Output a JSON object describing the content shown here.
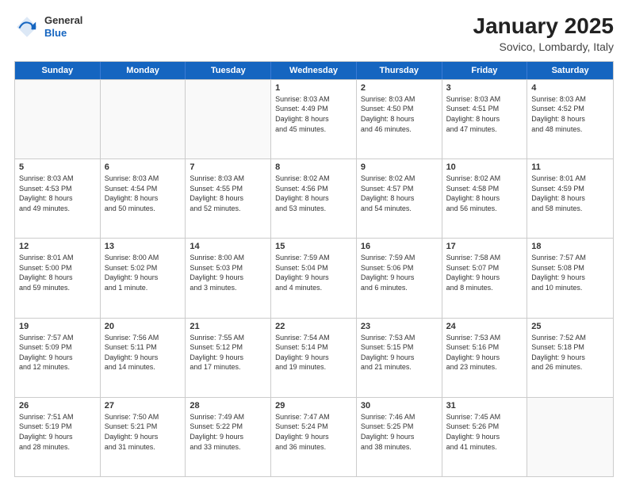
{
  "header": {
    "logo_general": "General",
    "logo_blue": "Blue",
    "month_title": "January 2025",
    "location": "Sovico, Lombardy, Italy"
  },
  "weekdays": [
    "Sunday",
    "Monday",
    "Tuesday",
    "Wednesday",
    "Thursday",
    "Friday",
    "Saturday"
  ],
  "weeks": [
    [
      {
        "day": "",
        "empty": true,
        "text": ""
      },
      {
        "day": "",
        "empty": true,
        "text": ""
      },
      {
        "day": "",
        "empty": true,
        "text": ""
      },
      {
        "day": "1",
        "empty": false,
        "text": "Sunrise: 8:03 AM\nSunset: 4:49 PM\nDaylight: 8 hours\nand 45 minutes."
      },
      {
        "day": "2",
        "empty": false,
        "text": "Sunrise: 8:03 AM\nSunset: 4:50 PM\nDaylight: 8 hours\nand 46 minutes."
      },
      {
        "day": "3",
        "empty": false,
        "text": "Sunrise: 8:03 AM\nSunset: 4:51 PM\nDaylight: 8 hours\nand 47 minutes."
      },
      {
        "day": "4",
        "empty": false,
        "text": "Sunrise: 8:03 AM\nSunset: 4:52 PM\nDaylight: 8 hours\nand 48 minutes."
      }
    ],
    [
      {
        "day": "5",
        "empty": false,
        "text": "Sunrise: 8:03 AM\nSunset: 4:53 PM\nDaylight: 8 hours\nand 49 minutes."
      },
      {
        "day": "6",
        "empty": false,
        "text": "Sunrise: 8:03 AM\nSunset: 4:54 PM\nDaylight: 8 hours\nand 50 minutes."
      },
      {
        "day": "7",
        "empty": false,
        "text": "Sunrise: 8:03 AM\nSunset: 4:55 PM\nDaylight: 8 hours\nand 52 minutes."
      },
      {
        "day": "8",
        "empty": false,
        "text": "Sunrise: 8:02 AM\nSunset: 4:56 PM\nDaylight: 8 hours\nand 53 minutes."
      },
      {
        "day": "9",
        "empty": false,
        "text": "Sunrise: 8:02 AM\nSunset: 4:57 PM\nDaylight: 8 hours\nand 54 minutes."
      },
      {
        "day": "10",
        "empty": false,
        "text": "Sunrise: 8:02 AM\nSunset: 4:58 PM\nDaylight: 8 hours\nand 56 minutes."
      },
      {
        "day": "11",
        "empty": false,
        "text": "Sunrise: 8:01 AM\nSunset: 4:59 PM\nDaylight: 8 hours\nand 58 minutes."
      }
    ],
    [
      {
        "day": "12",
        "empty": false,
        "text": "Sunrise: 8:01 AM\nSunset: 5:00 PM\nDaylight: 8 hours\nand 59 minutes."
      },
      {
        "day": "13",
        "empty": false,
        "text": "Sunrise: 8:00 AM\nSunset: 5:02 PM\nDaylight: 9 hours\nand 1 minute."
      },
      {
        "day": "14",
        "empty": false,
        "text": "Sunrise: 8:00 AM\nSunset: 5:03 PM\nDaylight: 9 hours\nand 3 minutes."
      },
      {
        "day": "15",
        "empty": false,
        "text": "Sunrise: 7:59 AM\nSunset: 5:04 PM\nDaylight: 9 hours\nand 4 minutes."
      },
      {
        "day": "16",
        "empty": false,
        "text": "Sunrise: 7:59 AM\nSunset: 5:06 PM\nDaylight: 9 hours\nand 6 minutes."
      },
      {
        "day": "17",
        "empty": false,
        "text": "Sunrise: 7:58 AM\nSunset: 5:07 PM\nDaylight: 9 hours\nand 8 minutes."
      },
      {
        "day": "18",
        "empty": false,
        "text": "Sunrise: 7:57 AM\nSunset: 5:08 PM\nDaylight: 9 hours\nand 10 minutes."
      }
    ],
    [
      {
        "day": "19",
        "empty": false,
        "text": "Sunrise: 7:57 AM\nSunset: 5:09 PM\nDaylight: 9 hours\nand 12 minutes."
      },
      {
        "day": "20",
        "empty": false,
        "text": "Sunrise: 7:56 AM\nSunset: 5:11 PM\nDaylight: 9 hours\nand 14 minutes."
      },
      {
        "day": "21",
        "empty": false,
        "text": "Sunrise: 7:55 AM\nSunset: 5:12 PM\nDaylight: 9 hours\nand 17 minutes."
      },
      {
        "day": "22",
        "empty": false,
        "text": "Sunrise: 7:54 AM\nSunset: 5:14 PM\nDaylight: 9 hours\nand 19 minutes."
      },
      {
        "day": "23",
        "empty": false,
        "text": "Sunrise: 7:53 AM\nSunset: 5:15 PM\nDaylight: 9 hours\nand 21 minutes."
      },
      {
        "day": "24",
        "empty": false,
        "text": "Sunrise: 7:53 AM\nSunset: 5:16 PM\nDaylight: 9 hours\nand 23 minutes."
      },
      {
        "day": "25",
        "empty": false,
        "text": "Sunrise: 7:52 AM\nSunset: 5:18 PM\nDaylight: 9 hours\nand 26 minutes."
      }
    ],
    [
      {
        "day": "26",
        "empty": false,
        "text": "Sunrise: 7:51 AM\nSunset: 5:19 PM\nDaylight: 9 hours\nand 28 minutes."
      },
      {
        "day": "27",
        "empty": false,
        "text": "Sunrise: 7:50 AM\nSunset: 5:21 PM\nDaylight: 9 hours\nand 31 minutes."
      },
      {
        "day": "28",
        "empty": false,
        "text": "Sunrise: 7:49 AM\nSunset: 5:22 PM\nDaylight: 9 hours\nand 33 minutes."
      },
      {
        "day": "29",
        "empty": false,
        "text": "Sunrise: 7:47 AM\nSunset: 5:24 PM\nDaylight: 9 hours\nand 36 minutes."
      },
      {
        "day": "30",
        "empty": false,
        "text": "Sunrise: 7:46 AM\nSunset: 5:25 PM\nDaylight: 9 hours\nand 38 minutes."
      },
      {
        "day": "31",
        "empty": false,
        "text": "Sunrise: 7:45 AM\nSunset: 5:26 PM\nDaylight: 9 hours\nand 41 minutes."
      },
      {
        "day": "",
        "empty": true,
        "text": ""
      }
    ]
  ]
}
